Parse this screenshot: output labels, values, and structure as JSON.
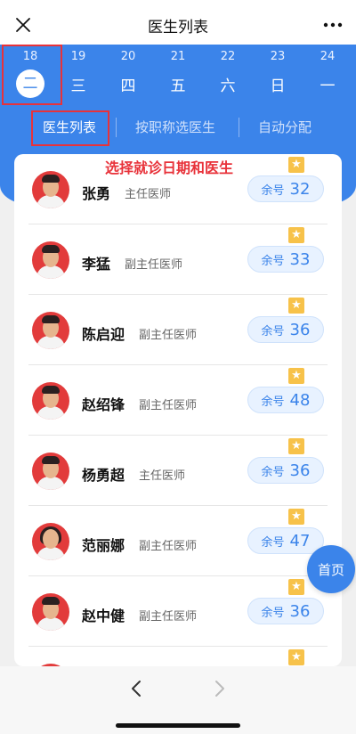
{
  "header": {
    "title": "医生列表"
  },
  "dates": [
    {
      "day": "18",
      "weekday": "二",
      "active": true
    },
    {
      "day": "19",
      "weekday": "三",
      "active": false
    },
    {
      "day": "20",
      "weekday": "四",
      "active": false
    },
    {
      "day": "21",
      "weekday": "五",
      "active": false
    },
    {
      "day": "22",
      "weekday": "六",
      "active": false
    },
    {
      "day": "23",
      "weekday": "日",
      "active": false
    },
    {
      "day": "24",
      "weekday": "一",
      "active": false
    }
  ],
  "tabs": [
    {
      "label": "医生列表",
      "active": true
    },
    {
      "label": "按职称选医生",
      "active": false
    },
    {
      "label": "自动分配",
      "active": false
    }
  ],
  "caption": "选择就诊日期和医生",
  "doctors": [
    {
      "name": "张勇",
      "title": "主任医师",
      "remaining_label": "余号",
      "remaining": "32"
    },
    {
      "name": "李猛",
      "title": "副主任医师",
      "remaining_label": "余号",
      "remaining": "33"
    },
    {
      "name": "陈启迎",
      "title": "副主任医师",
      "remaining_label": "余号",
      "remaining": "36"
    },
    {
      "name": "赵绍锋",
      "title": "副主任医师",
      "remaining_label": "余号",
      "remaining": "48"
    },
    {
      "name": "杨勇超",
      "title": "主任医师",
      "remaining_label": "余号",
      "remaining": "36"
    },
    {
      "name": "范丽娜",
      "title": "副主任医师",
      "remaining_label": "余号",
      "remaining": "47"
    },
    {
      "name": "赵中健",
      "title": "副主任医师",
      "remaining_label": "余号",
      "remaining": "36"
    }
  ],
  "floating": {
    "home_label": "首页"
  },
  "icons": {
    "close": "close-icon",
    "more": "more-icon",
    "star": "star-icon",
    "back": "chevron-left-icon",
    "forward": "chevron-right-icon"
  },
  "colors": {
    "primary": "#3b84ea",
    "annotation": "#e8323a",
    "star": "#f7c24a"
  }
}
